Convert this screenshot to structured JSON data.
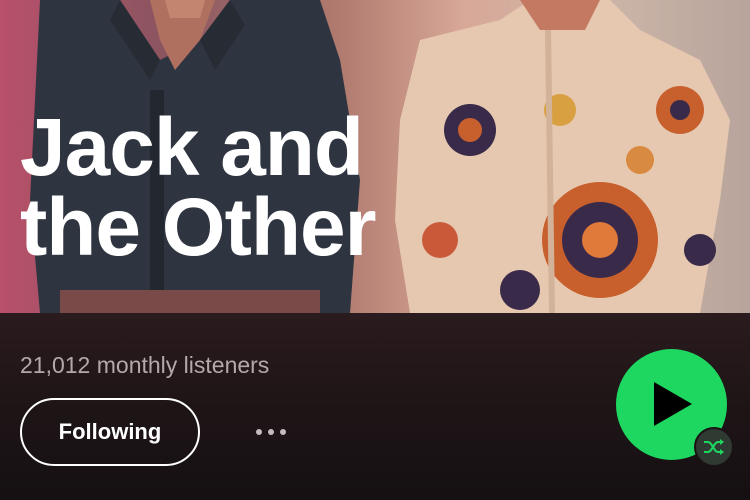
{
  "artist": {
    "name": "Jack and\nthe Other",
    "monthly_listeners": "21,012 monthly listeners"
  },
  "actions": {
    "follow_label": "Following"
  },
  "icons": {
    "more": "more-options-icon",
    "play": "play-icon",
    "shuffle": "shuffle-icon"
  },
  "colors": {
    "accent": "#1ed760",
    "text_primary": "#ffffff",
    "text_secondary": "#b3a9aa",
    "background": "#1a1214"
  }
}
